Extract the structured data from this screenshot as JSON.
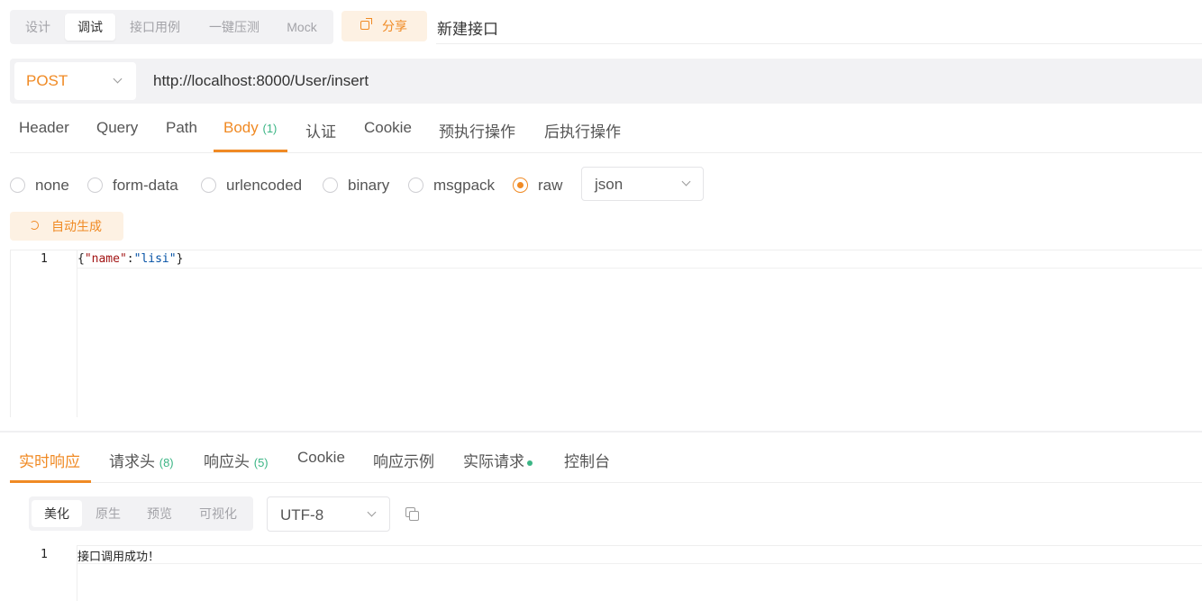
{
  "mode_tabs": [
    "设计",
    "调试",
    "接口用例",
    "一键压测",
    "Mock"
  ],
  "active_mode": "调试",
  "share_label": "分享",
  "api_name": "新建接口",
  "request": {
    "method": "POST",
    "url": "http://localhost:8000/User/insert"
  },
  "request_tabs": [
    {
      "label": "Header"
    },
    {
      "label": "Query"
    },
    {
      "label": "Path"
    },
    {
      "label": "Body",
      "count": "(1)"
    },
    {
      "label": "认证"
    },
    {
      "label": "Cookie"
    },
    {
      "label": "预执行操作"
    },
    {
      "label": "后执行操作"
    }
  ],
  "active_request_tab": "Body",
  "body_types": [
    "none",
    "form-data",
    "urlencoded",
    "binary",
    "msgpack",
    "raw"
  ],
  "selected_body_type": "raw",
  "raw_format": "json",
  "auto_generate_label": "自动生成",
  "editor": {
    "line_number": "1",
    "tokens": [
      {
        "t": "{",
        "c": "punc"
      },
      {
        "t": "\"name\"",
        "c": "key"
      },
      {
        "t": ":",
        "c": "punc"
      },
      {
        "t": "\"lisi\"",
        "c": "str"
      },
      {
        "t": "}",
        "c": "punc"
      }
    ]
  },
  "response_tabs": [
    {
      "label": "实时响应"
    },
    {
      "label": "请求头",
      "count": "(8)"
    },
    {
      "label": "响应头",
      "count": "(5)"
    },
    {
      "label": "Cookie"
    },
    {
      "label": "响应示例"
    },
    {
      "label": "实际请求",
      "dot": true
    },
    {
      "label": "控制台"
    }
  ],
  "active_response_tab": "实时响应",
  "view_tabs": [
    "美化",
    "原生",
    "预览",
    "可视化"
  ],
  "active_view": "美化",
  "encoding": "UTF-8",
  "response_body": {
    "line_number": "1",
    "text": "接口调用成功！"
  },
  "colors": {
    "accent": "#f08a24",
    "count_green": "#3bb585"
  },
  "icons": [
    "share-icon",
    "chevron-down-icon",
    "refresh-icon",
    "copy-icon"
  ]
}
